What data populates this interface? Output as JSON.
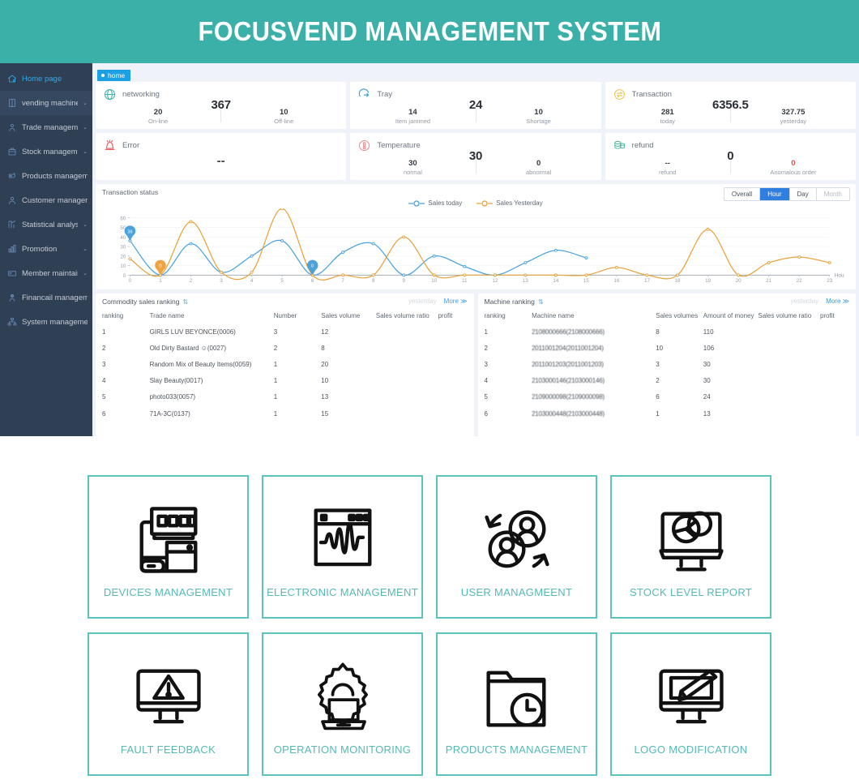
{
  "header": {
    "title": "FOCUSVEND MANAGEMENT SYSTEM",
    "bg": "#3bb0a8"
  },
  "sidebar": {
    "items": [
      {
        "label": "Home page",
        "icon": "home-icon",
        "caret": "",
        "active": true
      },
      {
        "label": "vending machine",
        "icon": "machine-icon",
        "caret": "⌄",
        "active": false
      },
      {
        "label": "Trade management",
        "icon": "trade-icon",
        "caret": "⌄",
        "active": false
      },
      {
        "label": "Stock management",
        "icon": "stock-icon",
        "caret": "⌄",
        "active": false
      },
      {
        "label": "Products management",
        "icon": "products-icon",
        "caret": "",
        "active": false
      },
      {
        "label": "Customer management",
        "icon": "customer-icon",
        "caret": "",
        "active": false
      },
      {
        "label": "Statistical analysis",
        "icon": "statistics-icon",
        "caret": "⌄",
        "active": false
      },
      {
        "label": "Promotion",
        "icon": "promotion-icon",
        "caret": "⌄",
        "active": false
      },
      {
        "label": "Member maintain",
        "icon": "member-icon",
        "caret": "⌄",
        "active": false
      },
      {
        "label": "Financail management",
        "icon": "finance-icon",
        "caret": "",
        "active": false
      },
      {
        "label": "System management",
        "icon": "system-icon",
        "caret": "",
        "active": false
      }
    ]
  },
  "tabbar": {
    "home_tab": "home"
  },
  "cards": [
    {
      "title": "networking",
      "icon": "globe-icon",
      "color": "#3bb6a6",
      "total": "367",
      "center_dash": "",
      "legs": [
        {
          "value": "20",
          "label": "On-line"
        },
        {
          "value": "10",
          "label": "Off-line"
        }
      ]
    },
    {
      "title": "Tray",
      "icon": "tray-icon",
      "color": "#2f9fd6",
      "total": "24",
      "center_dash": "",
      "legs": [
        {
          "value": "14",
          "label": "Item jammed"
        },
        {
          "value": "10",
          "label": "Shortage"
        }
      ]
    },
    {
      "title": "Transaction",
      "icon": "transaction-icon",
      "color": "#ecc24c",
      "total": "6356.5",
      "center_dash": "",
      "legs": [
        {
          "value": "281",
          "label": "today"
        },
        {
          "value": "327.75",
          "label": "yesterday"
        }
      ]
    },
    {
      "title": "Error",
      "icon": "alarm-icon",
      "color": "#ec5f5f",
      "total": "",
      "center_dash": "--",
      "legs": []
    },
    {
      "title": "Temperature",
      "icon": "thermometer-icon",
      "color": "#eb8a8a",
      "total": "30",
      "center_dash": "",
      "legs": [
        {
          "value": "30",
          "label": "normal"
        },
        {
          "value": "0",
          "label": "abnormal"
        }
      ]
    },
    {
      "title": "refund",
      "icon": "coins-icon",
      "color": "#4cb89a",
      "total": "0",
      "center_dash": "",
      "legs": [
        {
          "value": "--",
          "label": "refund"
        },
        {
          "value": "0",
          "label": "Anomalous order",
          "red": true
        }
      ]
    }
  ],
  "chart_panel": {
    "title": "Transaction status",
    "tabs": [
      {
        "label": "Overall",
        "state": "normal"
      },
      {
        "label": "Hour",
        "state": "active"
      },
      {
        "label": "Day",
        "state": "normal"
      },
      {
        "label": "Month",
        "state": "muted"
      }
    ]
  },
  "chart_data": {
    "type": "line",
    "title": "Transaction status",
    "xlabel": "Hou",
    "ylabel": "",
    "xlim": [
      0,
      23
    ],
    "ylim": [
      0,
      60
    ],
    "yticks": [
      0,
      10,
      20,
      30,
      40,
      50,
      60
    ],
    "xticks": [
      0,
      1,
      2,
      3,
      4,
      5,
      6,
      7,
      8,
      9,
      10,
      11,
      12,
      13,
      14,
      15,
      16,
      17,
      18,
      19,
      20,
      21,
      22,
      23
    ],
    "grid": true,
    "legend_position": "top-center",
    "series": [
      {
        "name": "Sales today",
        "color": "#4aa3dd",
        "values": [
          36,
          0,
          33,
          3,
          20,
          36,
          0,
          24,
          33,
          0,
          20,
          9,
          0,
          13,
          26,
          18,
          null,
          null,
          null,
          null,
          null,
          null,
          null,
          null
        ]
      },
      {
        "name": "Sales Yesterday",
        "color": "#e8a33d",
        "values": [
          17,
          0,
          56,
          3,
          3,
          69.75,
          0,
          0,
          0,
          40,
          0,
          0,
          0,
          0,
          0,
          0,
          8,
          0,
          0,
          48,
          0,
          13,
          19,
          13
        ]
      }
    ],
    "annotations": [
      {
        "series": "Sales today",
        "x": 0,
        "value": "36",
        "color": "#4aa3dd"
      },
      {
        "series": "Sales Yesterday",
        "x": 1,
        "value": "0",
        "color": "#f0a340"
      },
      {
        "series": "Sales Yesterday",
        "x": 5,
        "value": "69.75",
        "color": "#f0a340"
      },
      {
        "series": "Sales today",
        "x": 6,
        "value": "0",
        "color": "#4aa3dd"
      }
    ]
  },
  "commodity_panel": {
    "title": "Commodity sales ranking",
    "sort_icon": "⇅",
    "ghost_label": "yesterday",
    "more_label": "More ≫",
    "columns": [
      "ranking",
      "Trade name",
      "Number",
      "Sales volume",
      "Sales volume ratio",
      "profit"
    ],
    "rows": [
      [
        "1",
        "GIRLS LUV BEYONCE(0006)",
        "3",
        "12",
        "",
        ""
      ],
      [
        "2",
        "Old Dirty Bastard ☺(0027)",
        "2",
        "8",
        "",
        ""
      ],
      [
        "3",
        "Random Mix of Beauty Items(0059)",
        "1",
        "20",
        "",
        ""
      ],
      [
        "4",
        "Slay Beauty(0017)",
        "1",
        "10",
        "",
        ""
      ],
      [
        "5",
        "photo033(0057)",
        "1",
        "13",
        "",
        ""
      ],
      [
        "6",
        "71A-3C(0137)",
        "1",
        "15",
        "",
        ""
      ]
    ]
  },
  "machine_panel": {
    "title": "Machine ranking",
    "sort_icon": "⇅",
    "ghost_label": "yesterday",
    "more_label": "More ≫",
    "columns": [
      "ranking",
      "Machine name",
      "Sales volumes",
      "Amount of money",
      "Sales volume ratio",
      "profit"
    ],
    "rows": [
      [
        "1",
        "2108000666(2108000666)",
        "8",
        "110",
        "",
        ""
      ],
      [
        "2",
        "2011001204(2011001204)",
        "10",
        "106",
        "",
        ""
      ],
      [
        "3",
        "2011001203(2011001203)",
        "3",
        "30",
        "",
        ""
      ],
      [
        "4",
        "2103000146(2103000146)",
        "2",
        "30",
        "",
        ""
      ],
      [
        "5",
        "2109000098(2109000098)",
        "6",
        "24",
        "",
        ""
      ],
      [
        "6",
        "2103000448(2103000448)",
        "1",
        "13",
        "",
        ""
      ]
    ]
  },
  "tiles": [
    {
      "label": "DEVICES MANAGEMENT",
      "icon": "devices-icon"
    },
    {
      "label": "ELECTRONIC MANAGEMENT",
      "icon": "waveform-icon"
    },
    {
      "label": "USER MANAGMEENT",
      "icon": "users-icon"
    },
    {
      "label": "STOCK LEVEL REPORT",
      "icon": "monitor-pie-icon"
    },
    {
      "label": "FAULT FEEDBACK",
      "icon": "warning-monitor-icon"
    },
    {
      "label": "OPERATION MONITORING",
      "icon": "gear-laptop-icon"
    },
    {
      "label": "PRODUCTS MANAGEMENT",
      "icon": "folder-clock-icon"
    },
    {
      "label": "LOGO MODIFICATION",
      "icon": "monitor-brush-icon"
    }
  ],
  "colors": {
    "brand_teal": "#3bb0a8",
    "tile_border": "#5cc3bd",
    "tile_text": "#55b9b4",
    "sidebar": "#2f3f54",
    "accent_blue": "#2f7fe0"
  }
}
